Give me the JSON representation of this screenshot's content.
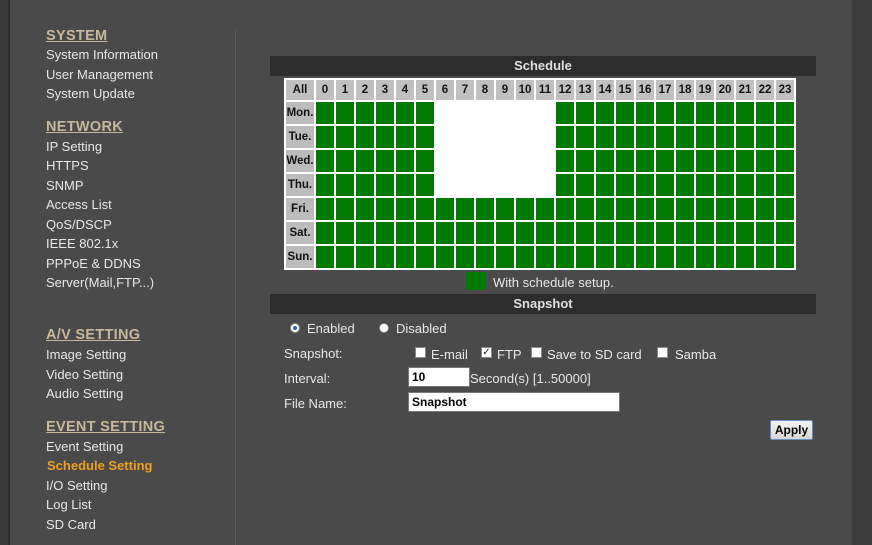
{
  "sidebar": {
    "sections": [
      {
        "title": "SYSTEM",
        "items": [
          "System Information",
          "User Management",
          "System Update"
        ]
      },
      {
        "title": "NETWORK",
        "items": [
          "IP Setting",
          "HTTPS",
          "SNMP",
          "Access List",
          "QoS/DSCP",
          "IEEE 802.1x",
          "PPPoE & DDNS",
          "Server(Mail,FTP...)"
        ]
      },
      {
        "title": "A/V SETTING",
        "items": [
          "Image Setting",
          "Video Setting",
          "Audio Setting"
        ]
      },
      {
        "title": "EVENT SETTING",
        "items": [
          "Event Setting",
          "Schedule Setting",
          "I/O Setting",
          "Log List",
          "SD Card"
        ]
      }
    ],
    "active_item": "Schedule Setting"
  },
  "schedule": {
    "title": "Schedule",
    "all_label": "All",
    "hours": [
      "0",
      "1",
      "2",
      "3",
      "4",
      "5",
      "6",
      "7",
      "8",
      "9",
      "10",
      "11",
      "12",
      "13",
      "14",
      "15",
      "16",
      "17",
      "18",
      "19",
      "20",
      "21",
      "22",
      "23"
    ],
    "days": [
      "Mon.",
      "Tue.",
      "Wed.",
      "Thu.",
      "Fri.",
      "Sat.",
      "Sun."
    ],
    "grid": [
      [
        1,
        1,
        1,
        1,
        1,
        1,
        0,
        0,
        0,
        0,
        0,
        0,
        1,
        1,
        1,
        1,
        1,
        1,
        1,
        1,
        1,
        1,
        1,
        1
      ],
      [
        1,
        1,
        1,
        1,
        1,
        1,
        0,
        0,
        0,
        0,
        0,
        0,
        1,
        1,
        1,
        1,
        1,
        1,
        1,
        1,
        1,
        1,
        1,
        1
      ],
      [
        1,
        1,
        1,
        1,
        1,
        1,
        0,
        0,
        0,
        0,
        0,
        0,
        1,
        1,
        1,
        1,
        1,
        1,
        1,
        1,
        1,
        1,
        1,
        1
      ],
      [
        1,
        1,
        1,
        1,
        1,
        1,
        0,
        0,
        0,
        0,
        0,
        0,
        1,
        1,
        1,
        1,
        1,
        1,
        1,
        1,
        1,
        1,
        1,
        1
      ],
      [
        1,
        1,
        1,
        1,
        1,
        1,
        1,
        1,
        1,
        1,
        1,
        1,
        1,
        1,
        1,
        1,
        1,
        1,
        1,
        1,
        1,
        1,
        1,
        1
      ],
      [
        1,
        1,
        1,
        1,
        1,
        1,
        1,
        1,
        1,
        1,
        1,
        1,
        1,
        1,
        1,
        1,
        1,
        1,
        1,
        1,
        1,
        1,
        1,
        1
      ],
      [
        1,
        1,
        1,
        1,
        1,
        1,
        1,
        1,
        1,
        1,
        1,
        1,
        1,
        1,
        1,
        1,
        1,
        1,
        1,
        1,
        1,
        1,
        1,
        1
      ]
    ],
    "legend": "With schedule setup.",
    "on_color": "#007a00",
    "off_color": "#ffffff"
  },
  "snapshot": {
    "title": "Snapshot",
    "enabled_label": "Enabled",
    "disabled_label": "Disabled",
    "state": "enabled",
    "snapshot_label": "Snapshot:",
    "email_label": "E-mail",
    "email_checked": false,
    "ftp_label": "FTP",
    "ftp_checked": true,
    "sd_label": "Save to SD card",
    "sd_checked": false,
    "samba_label": "Samba",
    "samba_checked": false,
    "interval_label": "Interval:",
    "interval_value": "10",
    "interval_unit": "Second(s) [1..50000]",
    "filename_label": "File Name:",
    "filename_value": "Snapshot",
    "apply_label": "Apply"
  },
  "colors": {
    "accent": "#f0a020",
    "section_title": "#c8b79a"
  }
}
